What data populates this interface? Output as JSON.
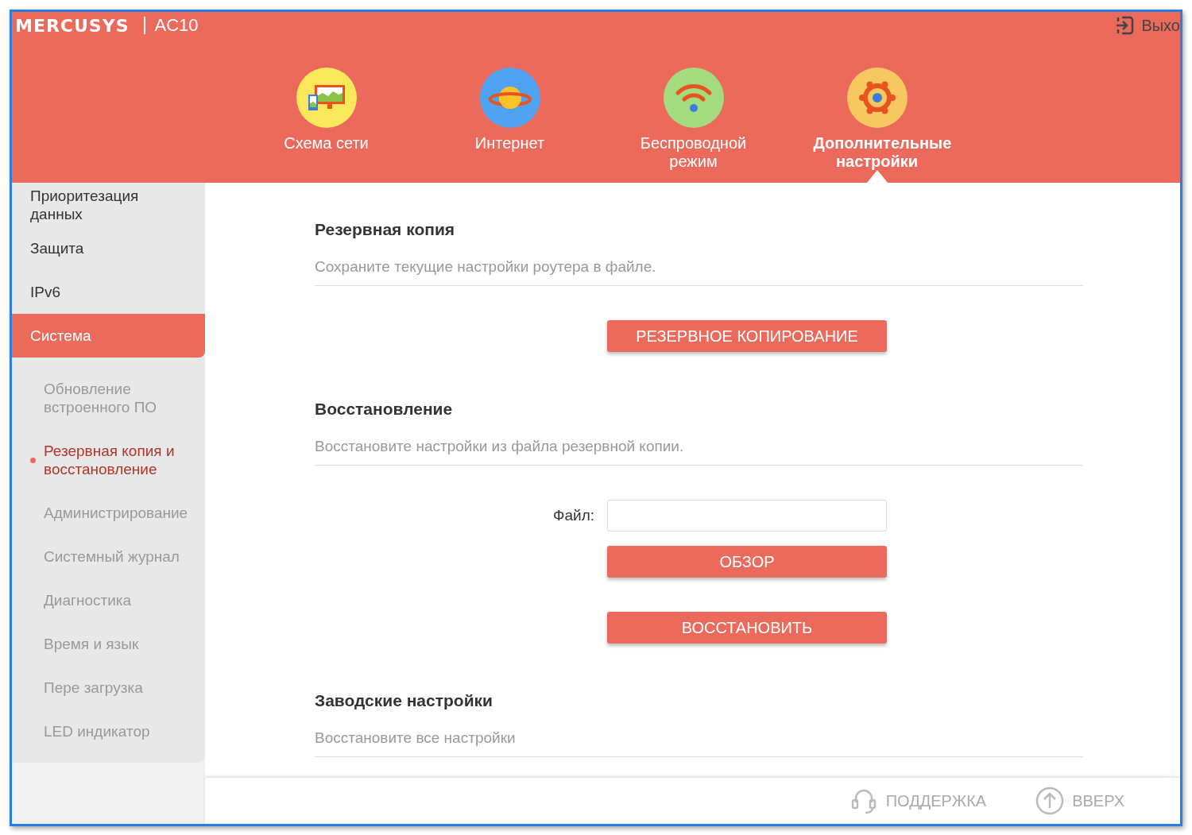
{
  "header": {
    "brand": "MERCUSYS",
    "model": "AC10",
    "logout": "Выхо"
  },
  "nav": [
    {
      "label": "Схема сети",
      "kind": "map",
      "selected": false
    },
    {
      "label": "Интернет",
      "kind": "planet",
      "selected": false
    },
    {
      "label": "Беспроводной режим",
      "kind": "wifi",
      "selected": false
    },
    {
      "label": "Дополнительные настройки",
      "kind": "gear",
      "selected": true
    }
  ],
  "sidebar": [
    {
      "label": "Приоритезация данных",
      "selected": false
    },
    {
      "label": "Защита",
      "selected": false
    },
    {
      "label": "IPv6",
      "selected": false
    },
    {
      "label": "Система",
      "selected": true,
      "children": [
        {
          "label": "Обновление встроенного ПО",
          "selected": false
        },
        {
          "label": "Резервная копия и восстановление",
          "selected": true
        },
        {
          "label": "Администрирование",
          "selected": false
        },
        {
          "label": "Системный журнал",
          "selected": false
        },
        {
          "label": "Диагностика",
          "selected": false
        },
        {
          "label": "Время и язык",
          "selected": false
        },
        {
          "label": "Пере загрузка",
          "selected": false
        },
        {
          "label": "LED индикатор",
          "selected": false
        }
      ]
    }
  ],
  "sections": [
    {
      "title": "Резервная копия",
      "description": "Сохраните текущие настройки роутера в файле.",
      "controls": [
        {
          "kind": "button",
          "label": "РЕЗЕРВНОЕ КОПИРОВАНИЕ"
        }
      ]
    },
    {
      "title": "Восстановление",
      "description": "Восстановите настройки из файла резервной копии.",
      "controls": [
        {
          "kind": "file",
          "label": "Файл:"
        },
        {
          "kind": "button",
          "label": "ОБЗОР"
        },
        {
          "kind": "button",
          "label": "ВОССТАНОВИТЬ"
        }
      ]
    },
    {
      "title": "Заводские настройки",
      "description": "Восстановите все настройки"
    }
  ],
  "footer": [
    {
      "label": "ПОДДЕРЖКА",
      "kind": "support"
    },
    {
      "label": "ВВЕРХ",
      "kind": "top"
    }
  ]
}
